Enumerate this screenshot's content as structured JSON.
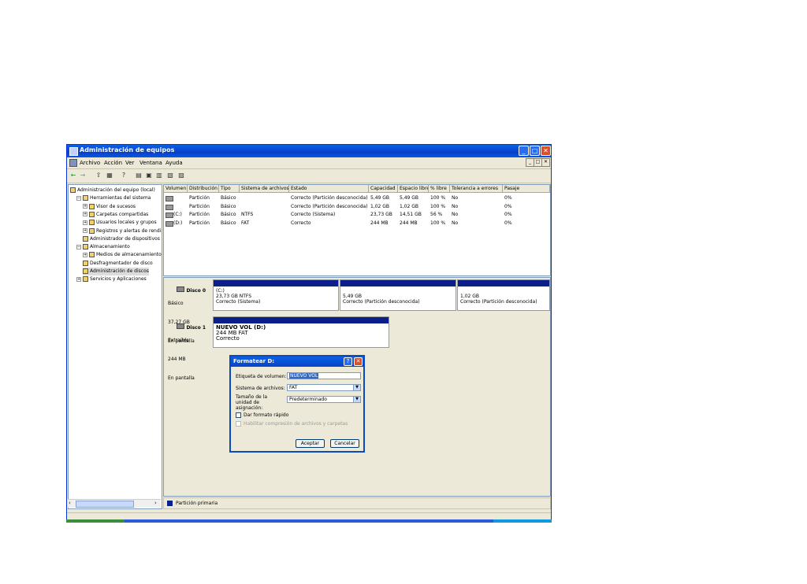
{
  "window": {
    "title": "Administración de equipos",
    "controls": {
      "minimize": "_",
      "maximize": "□",
      "close": "✕"
    }
  },
  "menu": [
    "Archivo",
    "Acción",
    "Ver",
    "Ventana",
    "Ayuda"
  ],
  "mdi_controls": [
    "_",
    "□",
    "✕"
  ],
  "toolbar_icons": [
    "back-icon",
    "forward-icon",
    "up-icon",
    "properties-icon",
    "help-icon",
    "refresh-icon",
    "export-icon",
    "folder-icon",
    "disk-icon",
    "wizard-icon"
  ],
  "tree": [
    {
      "label": "Administración del equipo (local)",
      "indent": 0,
      "expander": ""
    },
    {
      "label": "Herramientas del sistema",
      "indent": 1,
      "expander": "−"
    },
    {
      "label": "Visor de sucesos",
      "indent": 2,
      "expander": "+"
    },
    {
      "label": "Carpetas compartidas",
      "indent": 2,
      "expander": "+"
    },
    {
      "label": "Usuarios locales y grupos",
      "indent": 2,
      "expander": "+"
    },
    {
      "label": "Registros y alertas de rendimiento",
      "indent": 2,
      "expander": "+"
    },
    {
      "label": "Administrador de dispositivos",
      "indent": 2,
      "expander": ""
    },
    {
      "label": "Almacenamiento",
      "indent": 1,
      "expander": "−"
    },
    {
      "label": "Medios de almacenamiento extraíbles",
      "indent": 2,
      "expander": "+"
    },
    {
      "label": "Desfragmentador de disco",
      "indent": 2,
      "expander": ""
    },
    {
      "label": "Administración de discos",
      "indent": 2,
      "expander": "",
      "selected": true
    },
    {
      "label": "Servicios y Aplicaciones",
      "indent": 1,
      "expander": "+"
    }
  ],
  "volume_table": {
    "headers": [
      "Volumen",
      "Distribución",
      "Tipo",
      "Sistema de archivos",
      "Estado",
      "Capacidad",
      "Espacio libre",
      "% libre",
      "Tolerancia a errores",
      "Pasaje"
    ],
    "rows": [
      [
        "",
        "Partición",
        "Básico",
        "",
        "Correcto (Partición desconocida)",
        "5,49 GB",
        "5,49 GB",
        "100 %",
        "No",
        "0%"
      ],
      [
        "",
        "Partición",
        "Básico",
        "",
        "Correcto (Partición desconocida)",
        "1,02 GB",
        "1,02 GB",
        "100 %",
        "No",
        "0%"
      ],
      [
        "(C:)",
        "Partición",
        "Básico",
        "NTFS",
        "Correcto (Sistema)",
        "23,73 GB",
        "14,51 GB",
        "56 %",
        "No",
        "0%"
      ],
      [
        "(D:)",
        "Partición",
        "Básico",
        "FAT",
        "Correcto",
        "244 MB",
        "244 MB",
        "100 %",
        "No",
        "0%"
      ]
    ]
  },
  "disks": [
    {
      "label": "Disco 0",
      "type": "Básico",
      "size": "37,27 GB",
      "status": "En pantalla",
      "partitions": [
        {
          "name": "(C:)",
          "detail": "23,73 GB NTFS",
          "status": "Correcto (Sistema)"
        },
        {
          "name": "",
          "detail": "5,49 GB",
          "status": "Correcto (Partición desconocida)"
        },
        {
          "name": "",
          "detail": "1,02 GB",
          "status": "Correcto (Partición desconocida)"
        }
      ]
    },
    {
      "label": "Disco 1",
      "type": "Extraíble",
      "size": "244 MB",
      "status": "En pantalla",
      "partitions": [
        {
          "name": "NUEVO VOL (D:)",
          "detail": "244 MB FAT",
          "status": "Correcto"
        }
      ]
    }
  ],
  "legend": {
    "label": "Partición primaria",
    "color": "#0a1f8a"
  },
  "dialog": {
    "title": "Formatear D:",
    "help": "?",
    "close": "✕",
    "volume_label_text": "Etiqueta de volumen:",
    "volume_label_value": "NUEVO VOL",
    "filesystem_text": "Sistema de archivos:",
    "filesystem_value": "FAT",
    "alloc_text": "Tamaño de la unidad de asignación:",
    "alloc_value": "Predeterminado",
    "quick_format": "Dar formato rápido",
    "compression": "Habilitar compresión de archivos y carpetas",
    "ok": "Aceptar",
    "cancel": "Cancelar"
  },
  "colors": {
    "titlebar": "#0a5fe8",
    "partition_primary": "#0a1f8a"
  }
}
